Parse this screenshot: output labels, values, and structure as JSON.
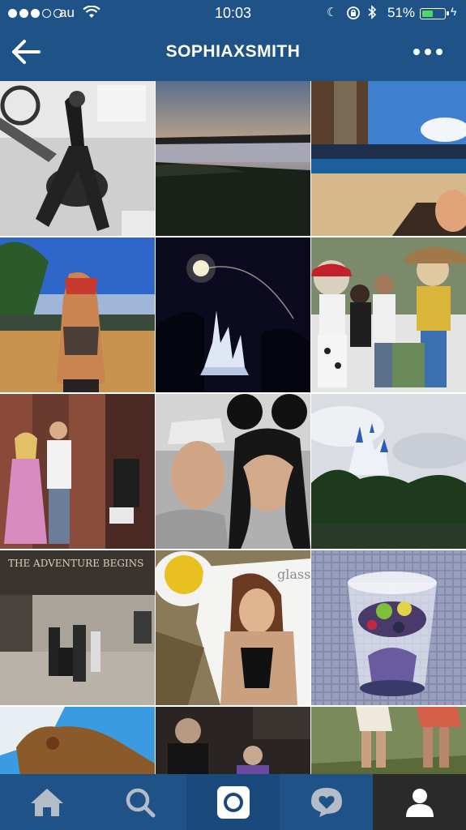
{
  "status_bar": {
    "carrier": "au",
    "time": "10:03",
    "battery": "51%",
    "battery_level": 0.51,
    "signal_filled": 3,
    "signal_total": 5
  },
  "header": {
    "title": "SOPHIAXSMITH",
    "back_icon": "back-arrow-icon",
    "more_icon": "more-dots-icon"
  },
  "colors": {
    "brand_bar": "#1f5287",
    "battery_green": "#4cd964"
  },
  "tabs": [
    {
      "name": "home",
      "icon": "home-icon",
      "active": false
    },
    {
      "name": "search",
      "icon": "search-icon",
      "active": false
    },
    {
      "name": "camera",
      "icon": "camera-icon",
      "active": true
    },
    {
      "name": "activity",
      "icon": "activity-heart-icon",
      "active": false
    },
    {
      "name": "profile",
      "icon": "profile-icon",
      "active": false
    }
  ],
  "photo_captions": {
    "adventure_sign": "THE ADVENTURE BEGINS",
    "magazine_word": "glass"
  }
}
